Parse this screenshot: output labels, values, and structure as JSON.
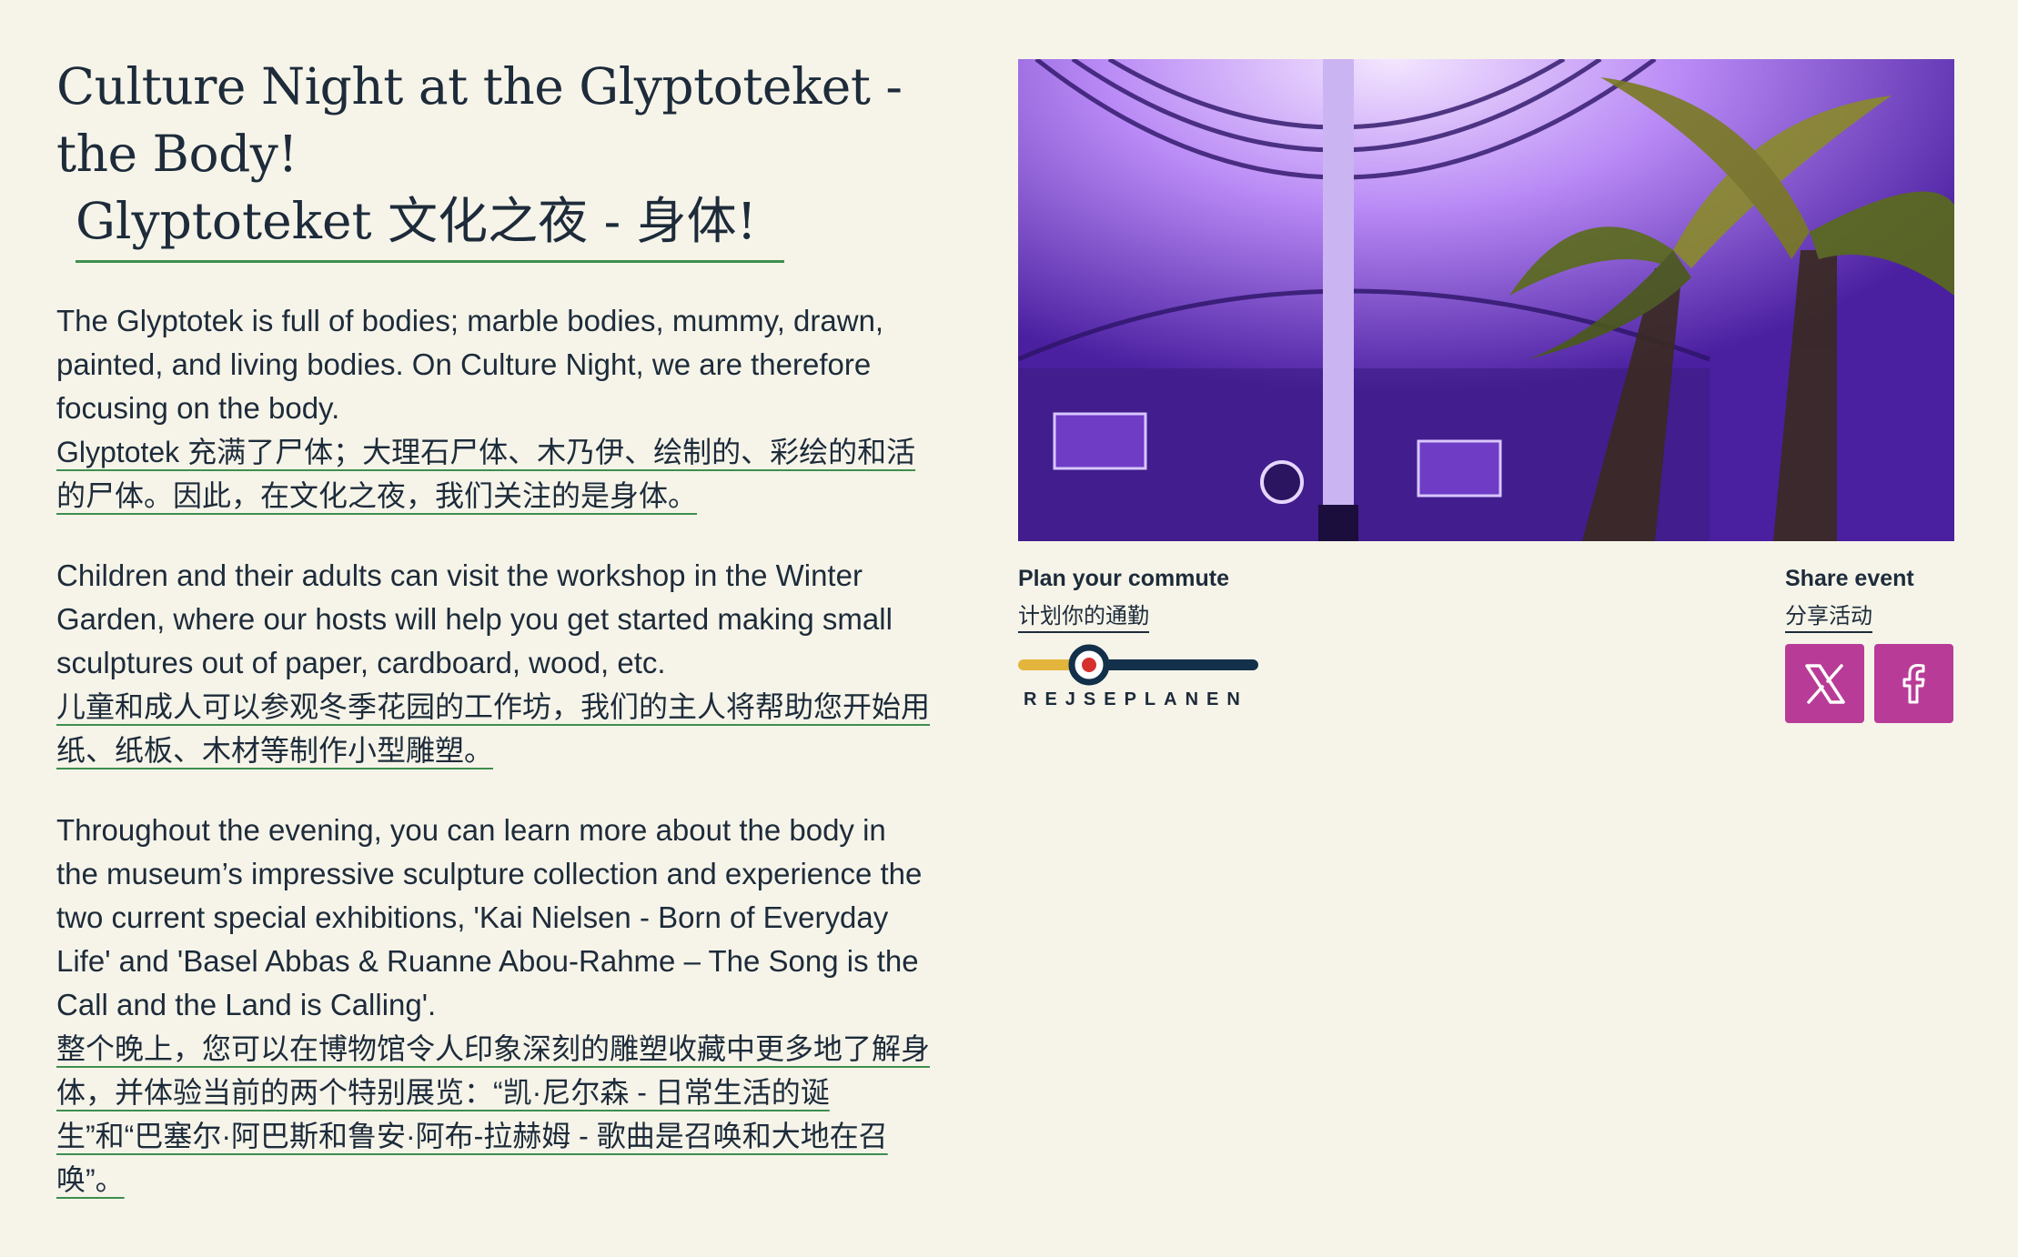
{
  "event": {
    "title_en": "Culture Night at the Glyptoteket - the Body!",
    "title_zh": "Glyptoteket 文化之夜 - 身体!"
  },
  "paragraphs": [
    {
      "en": "The Glyptotek is full of bodies; marble bodies, mummy, drawn, painted, and living bodies. On Culture Night, we are therefore focusing on the body.",
      "zh": "Glyptotek 充满了尸体；大理石尸体、木乃伊、绘制的、彩绘的和活的尸体。因此，在文化之夜，我们关注的是身体。"
    },
    {
      "en": "Children and their adults can visit the workshop in the Winter Garden, where our hosts will help you get started making small sculptures out of paper, cardboard, wood, etc.",
      "zh": "儿童和成人可以参观冬季花园的工作坊，我们的主人将帮助您开始用纸、纸板、木材等制作小型雕塑。"
    },
    {
      "en": "Throughout the evening, you can learn more about the body in the museum’s impressive sculpture collection and experience the two current special exhibitions, 'Kai Nielsen - Born of Everyday Life' and 'Basel Abbas & Ruanne Abou-Rahme – The Song is the Call and the Land is Calling'.",
      "zh": "整个晚上，您可以在博物馆令人印象深刻的雕塑收藏中更多地了解身体，并体验当前的两个特别展览：“凯·尼尔森 - 日常生活的诞生”和“巴塞尔·阿巴斯和鲁安·阿布-拉赫姆 - 歌曲是召唤和大地在召唤”。"
    }
  ],
  "commute": {
    "label_en": "Plan your commute",
    "label_zh": "计划你的通勤",
    "logo_text": "REJSEPLANEN"
  },
  "share": {
    "label_en": "Share event",
    "label_zh": "分享活动"
  },
  "colors": {
    "background": "#f6f4e9",
    "text": "#1d2b3a",
    "underline_green": "#3e8e4e",
    "social_button": "#b83c97",
    "rejseplanen_yellow": "#e3b53c",
    "rejseplanen_navy": "#12304a"
  },
  "icons": {
    "x_button": "x-logo-icon",
    "facebook_button": "facebook-icon"
  }
}
